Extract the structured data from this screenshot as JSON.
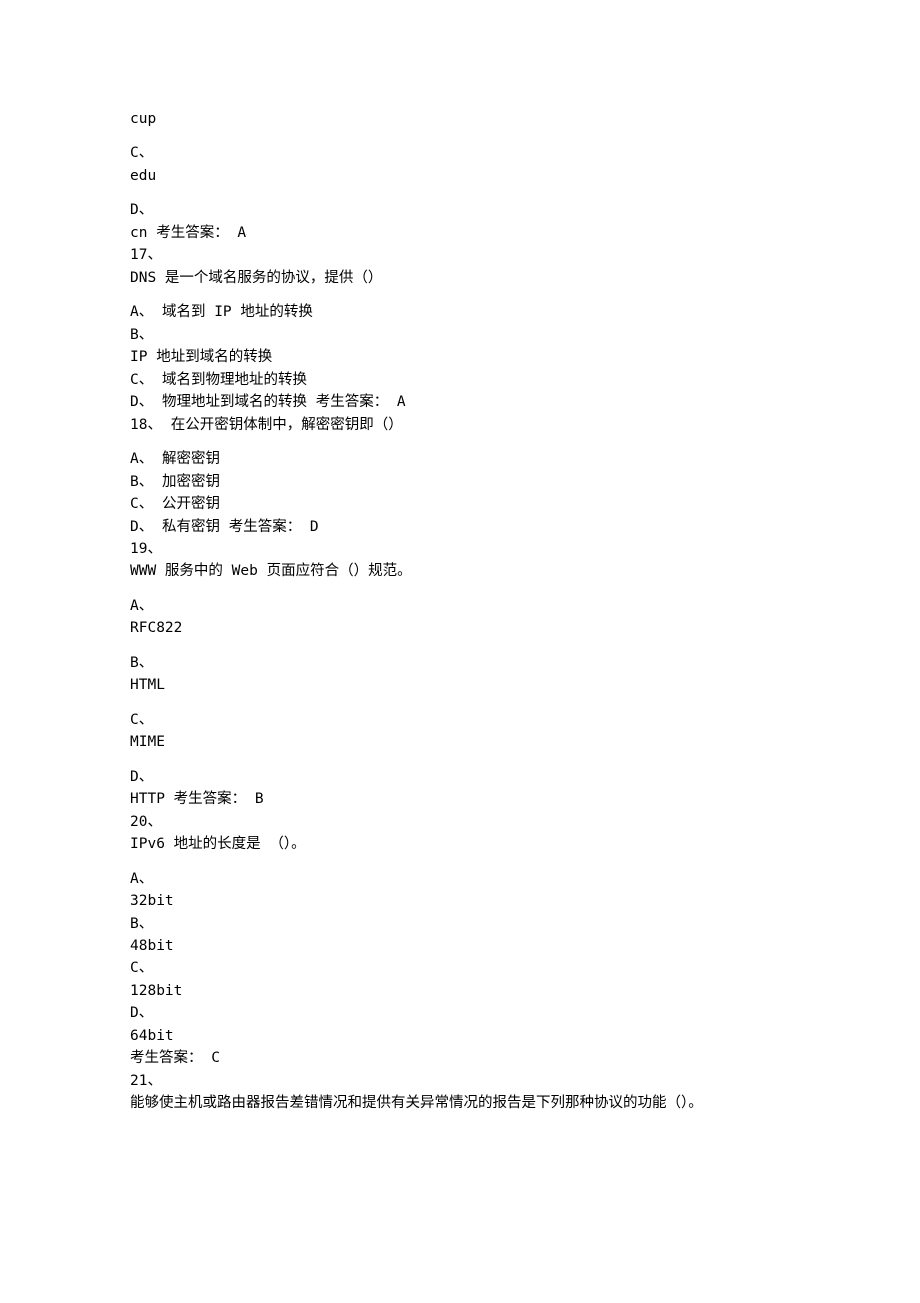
{
  "lines": [
    "cup",
    "",
    "C、",
    "edu",
    "",
    "D、",
    "cn 考生答案： A",
    "17、",
    "DNS 是一个域名服务的协议，提供（）",
    "",
    "A、 域名到 IP 地址的转换",
    "B、",
    "IP 地址到域名的转换",
    "C、 域名到物理地址的转换",
    "D、 物理地址到域名的转换 考生答案： A",
    "18、 在公开密钥体制中，解密密钥即（）",
    "",
    "A、 解密密钥",
    "B、 加密密钥",
    "C、 公开密钥",
    "D、 私有密钥 考生答案： D",
    "19、",
    "WWW 服务中的 Web 页面应符合（）规范。",
    "",
    "A、",
    "RFC822",
    "",
    "B、",
    "HTML",
    "",
    "C、",
    "MIME",
    "",
    "D、",
    "HTTP 考生答案： B",
    "20、",
    "IPv6 地址的长度是 （）。",
    "",
    "A、",
    "32bit",
    "B、",
    "48bit",
    "C、",
    "128bit",
    "D、",
    "64bit",
    "考生答案： C",
    "21、",
    "能够使主机或路由器报告差错情况和提供有关异常情况的报告是下列那种协议的功能（）。"
  ]
}
